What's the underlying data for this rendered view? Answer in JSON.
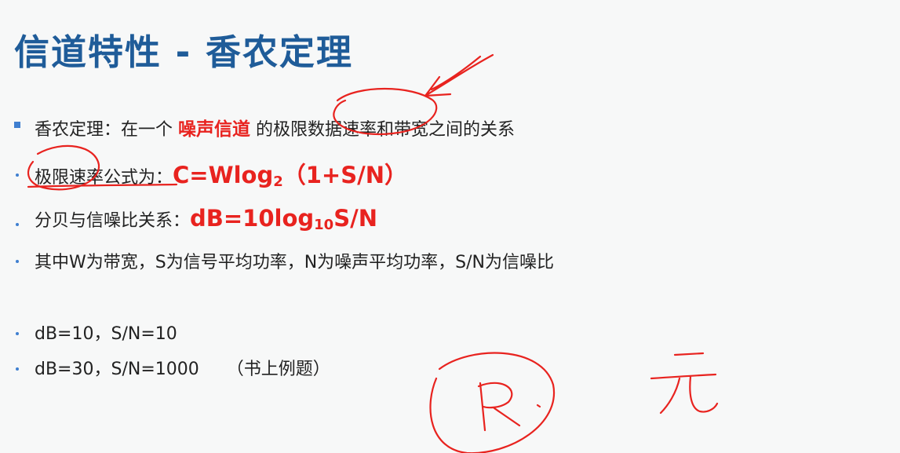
{
  "title": "信道特性 - 香农定理",
  "bullets": {
    "b1": {
      "prefix": "香农定理：在一个 ",
      "highlight": "噪声信道",
      "suffix": " 的极限数据速率和带宽之间的关系"
    },
    "b2": {
      "label": "极限速率公式为：",
      "formula_main": "C=Wlog",
      "formula_sub": "2",
      "formula_tail": "（1+S/N）"
    },
    "b3": {
      "label": "分贝与信噪比关系：",
      "formula_main": "dB=10log",
      "formula_sub": "10",
      "formula_tail": "S/N"
    },
    "b4": {
      "text": "其中W为带宽，S为信号平均功率，N为噪声平均功率，S/N为信噪比"
    },
    "b5": {
      "text": "dB=10，S/N=10"
    },
    "b6": {
      "text": "dB=30，S/N=1000     （书上例题）"
    }
  },
  "colors": {
    "title": "#1f5c99",
    "accent_red": "#e8231f",
    "bullet_marker": "#3f7fd0",
    "text": "#222222",
    "background": "#f7f8f8"
  }
}
